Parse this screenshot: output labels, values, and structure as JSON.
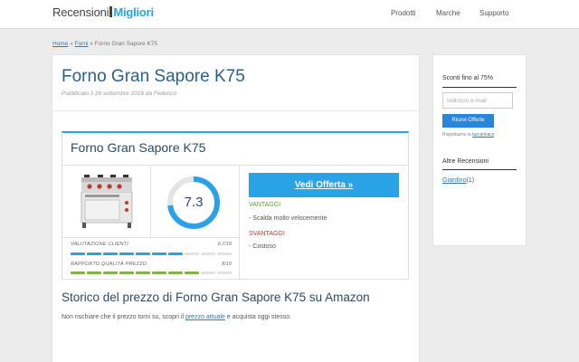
{
  "header": {
    "logo_part1": "Recensioni",
    "logo_part2": "Migliori",
    "nav": [
      "Prodotti",
      "Marche",
      "Supporto"
    ]
  },
  "breadcrumb": {
    "home": "Home",
    "sep1": "»",
    "forni": "Forni",
    "sep2": "»",
    "current": "Forno Gran Sapore K75"
  },
  "post": {
    "title": "Forno Gran Sapore K75",
    "meta": "Pubblicato il 26 settembre 2016 da Federico"
  },
  "product_card": {
    "title": "Forno Gran Sapore K75",
    "score": "7.3",
    "score_value": 7.3,
    "score_max": 10,
    "ratings": [
      {
        "label": "VALUTAZIONE CLIENTI",
        "score_text": "6.7/10",
        "value": 6.7,
        "color": "#2aa3e6"
      },
      {
        "label": "RAPPORTO QUALITÀ PREZZO",
        "score_text": "8/10",
        "value": 8,
        "color": "#7ab648"
      }
    ],
    "offer_button": "Vedi Offerta »",
    "pros_heading": "VANTAGGI",
    "pros": [
      "- Scalda molto velocemente"
    ],
    "cons_heading": "SVANTAGGI",
    "cons": [
      "- Costoso"
    ],
    "accent_color": "#2aa3e6"
  },
  "history": {
    "title": "Storico del prezzo di Forno Gran Sapore K75 su Amazon",
    "text_before": "Non rischiare che il prezzo torni su, scopri il ",
    "link": "prezzo attuale",
    "text_after": " e acquista oggi stesso."
  },
  "sidebar": {
    "newsletter_heading": "Sconti fino al 75%",
    "email_placeholder": "Indirizzo e-mail",
    "submit_label": "Ricevi Offerte",
    "privacy_before": "Rispettiamo la ",
    "privacy_link": "tua privacy",
    "privacy_after": ".",
    "reviews_heading": "Altre Recensioni",
    "reviews": [
      {
        "label": "Giardino",
        "count": "(1)"
      }
    ]
  }
}
